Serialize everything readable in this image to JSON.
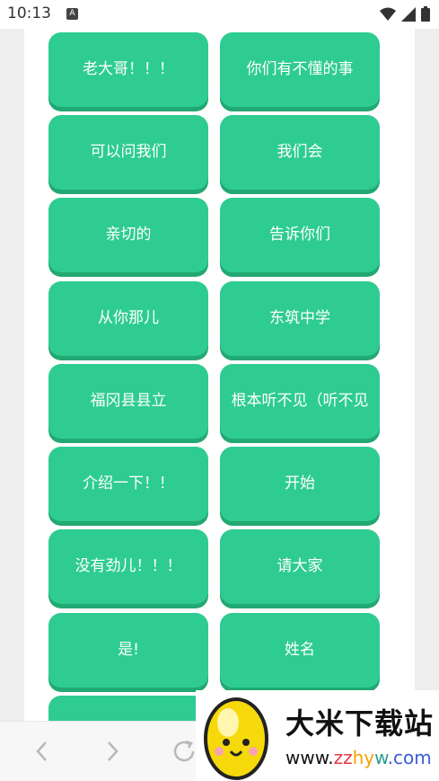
{
  "status_bar": {
    "time": "10:13",
    "notification_letter": "A",
    "wifi_icon": "wifi-icon",
    "signal_icon": "signal-icon",
    "battery_icon": "battery-icon"
  },
  "buttons": [
    {
      "label": "老大哥！！！"
    },
    {
      "label": "你们有不懂的事"
    },
    {
      "label": "可以问我们"
    },
    {
      "label": "我们会"
    },
    {
      "label": "亲切的"
    },
    {
      "label": "告诉你们"
    },
    {
      "label": "从你那儿"
    },
    {
      "label": "东筑中学"
    },
    {
      "label": "福冈县县立"
    },
    {
      "label": "根本听不见（听不见"
    },
    {
      "label": "介绍一下！！"
    },
    {
      "label": "开始"
    },
    {
      "label": "没有劲儿！！！"
    },
    {
      "label": "请大家"
    },
    {
      "label": "是!"
    },
    {
      "label": "姓名"
    },
    {
      "label": ""
    }
  ],
  "nav": {
    "back_icon": "chevron-left-icon",
    "forward_icon": "chevron-right-icon",
    "reload_icon": "reload-icon"
  },
  "watermark": {
    "title": "大米下载站",
    "url": "www.zzhyw.com",
    "colors": {
      "url_zz": "#e63946",
      "url_hy": "#f4a300",
      "url_w": "#2a9d8f",
      "url_com": "#3a5bd9"
    }
  },
  "colors": {
    "button": "#2ecc91",
    "button_shadow": "#22a872",
    "button_text": "#ffffff"
  }
}
